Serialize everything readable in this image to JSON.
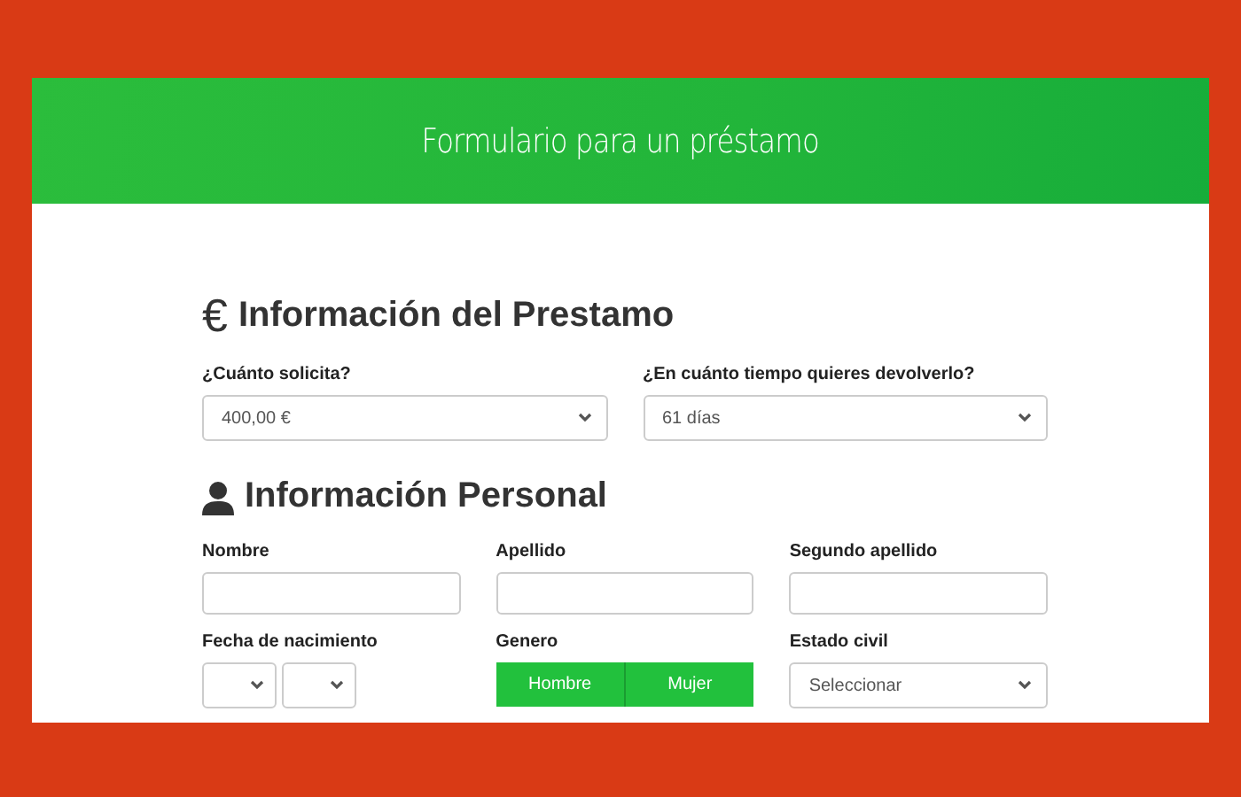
{
  "header": {
    "title": "Formulario para un préstamo"
  },
  "loan_section": {
    "icon": "€",
    "title": "Información del Prestamo",
    "fields": [
      {
        "label": "¿Cuánto solicita?",
        "value": "400,00 €"
      },
      {
        "label": "¿En cuánto tiempo quieres devolverlo?",
        "value": "61 días"
      }
    ]
  },
  "personal_section": {
    "title": "Información Personal",
    "name_fields": [
      {
        "label": "Nombre"
      },
      {
        "label": "Apellido"
      },
      {
        "label": "Segundo apellido"
      }
    ],
    "birth_date": {
      "label": "Fecha de nacimiento"
    },
    "gender": {
      "label": "Genero",
      "options": [
        "Hombre",
        "Mujer"
      ]
    },
    "marital_status": {
      "label": "Estado civil",
      "value": "Seleccionar"
    }
  }
}
